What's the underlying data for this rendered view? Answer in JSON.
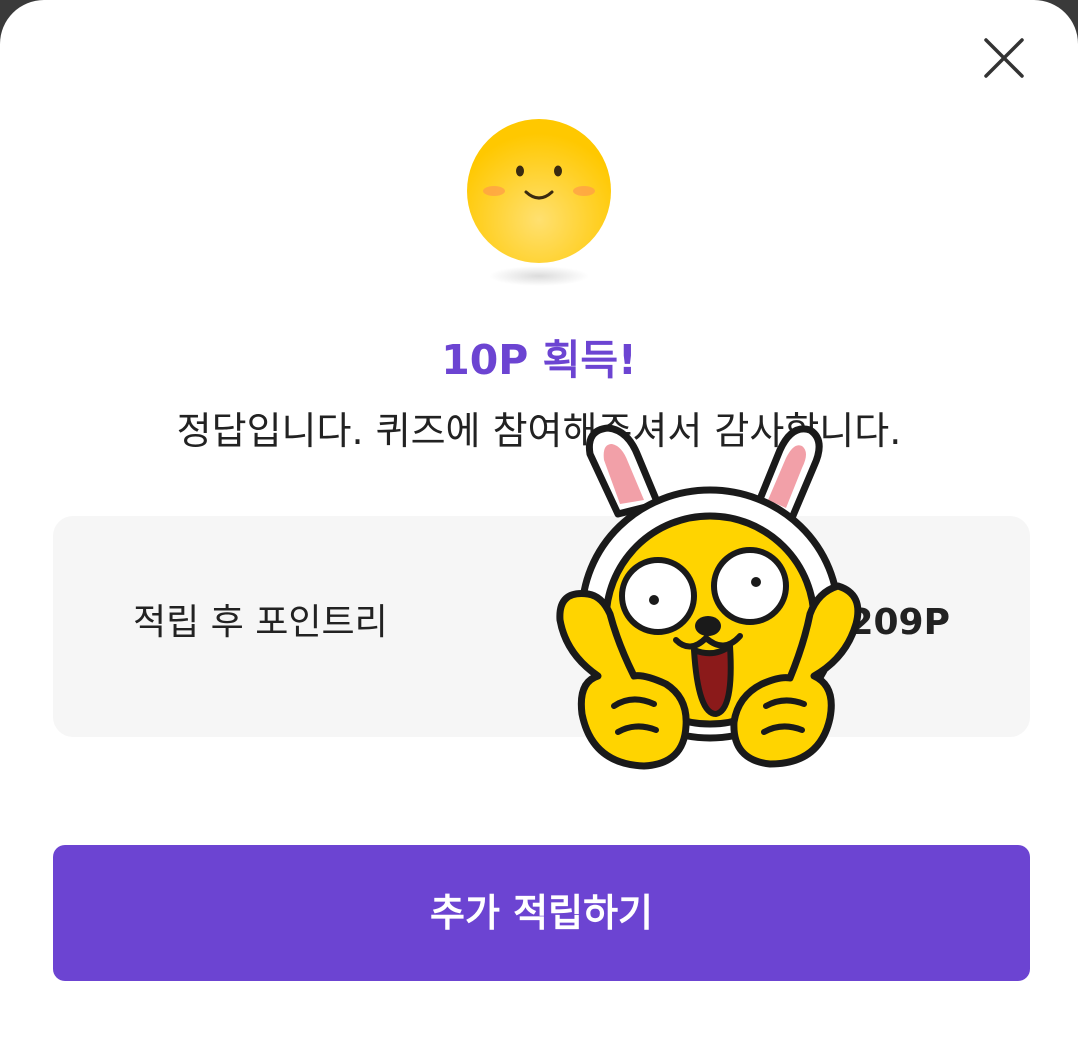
{
  "dialog": {
    "title": "10P 획득!",
    "message": "정답입니다. 퀴즈에 참여해주셔서 감사합니다.",
    "points_label": "적립 후 포인트리",
    "points_value": "2,209P",
    "cta_label": "추가 적립하기"
  },
  "icons": {
    "close": "close-icon",
    "smiley": "smiley-face-icon",
    "character": "rabbit-character-sticker"
  },
  "colors": {
    "accent": "#6c44d2",
    "smiley": "#ffcc00",
    "box_background": "#f6f6f6"
  }
}
